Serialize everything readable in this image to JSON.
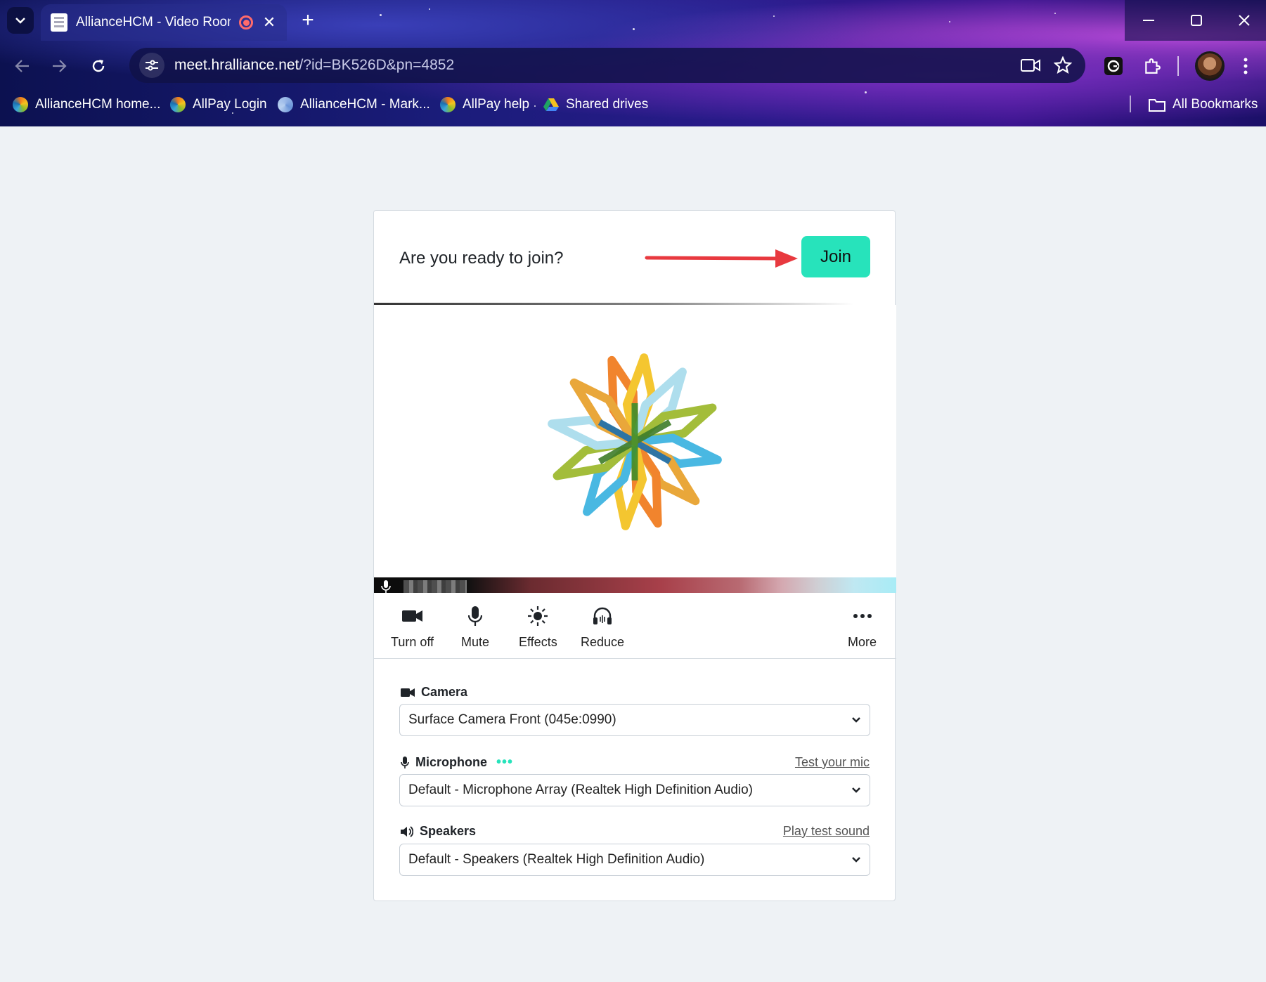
{
  "browser": {
    "tab_title": "AllianceHCM - Video Room",
    "url_host": "meet.hralliance.net",
    "url_path": "/?id=BK526D&pn=4852",
    "bookmarks": [
      {
        "label": "AllianceHCM home..."
      },
      {
        "label": "AllPay Login"
      },
      {
        "label": "AllianceHCM - Mark..."
      },
      {
        "label": "AllPay help"
      },
      {
        "label": "Shared drives"
      }
    ],
    "all_bookmarks": "All Bookmarks"
  },
  "join": {
    "question": "Are you ready to join?",
    "button": "Join"
  },
  "controls": {
    "turn_off": "Turn off",
    "mute": "Mute",
    "effects": "Effects",
    "reduce": "Reduce",
    "more": "More"
  },
  "devices": {
    "camera": {
      "label": "Camera",
      "value": "Surface Camera Front (045e:0990)"
    },
    "microphone": {
      "label": "Microphone",
      "link": "Test your mic",
      "value": "Default - Microphone Array (Realtek High Definition Audio)"
    },
    "speakers": {
      "label": "Speakers",
      "link": "Play test sound",
      "value": "Default - Speakers (Realtek High Definition Audio)"
    }
  },
  "colors": {
    "accent": "#27e3bb",
    "arrow": "#e8393f"
  }
}
